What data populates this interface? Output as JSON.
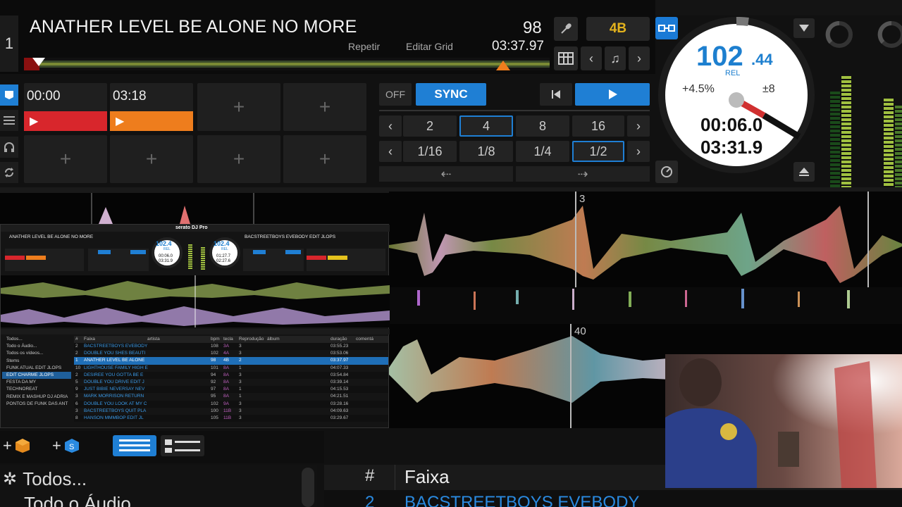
{
  "deck": {
    "number": "1",
    "title": "ANATHER LEVEL BE ALONE NO MORE",
    "bpm_small": "98",
    "repeat_label": "Repetir",
    "edit_grid_label": "Editar Grid",
    "time_remaining": "03:37.97",
    "key": "4B"
  },
  "cues": [
    {
      "time": "00:00",
      "color": "#d8262c"
    },
    {
      "time": "03:18",
      "color": "#ee7d1d"
    }
  ],
  "transport": {
    "off_label": "OFF",
    "sync_label": "SYNC",
    "beat_jump": [
      "2",
      "4",
      "8",
      "16"
    ],
    "beat_jump_active": "4",
    "loop_sizes": [
      "1/16",
      "1/8",
      "1/4",
      "1/2"
    ],
    "loop_active": "1/2"
  },
  "platter": {
    "bpm_int": "102",
    "bpm_dec": ".44",
    "rel_label": "REL",
    "pitch": "+4.5%",
    "range": "±8",
    "elapsed": "00:06.0",
    "remaining": "03:31.9"
  },
  "waveform": {
    "marker_top": "3",
    "marker_bottom": "40"
  },
  "embedded": {
    "app_name": "serato DJ Pro",
    "deck1_title": "ANATHER LEVEL BE ALONE NO MORE",
    "deck2_title": "BACSTREETBOYS EVEBODY EDIT JLOPS",
    "deck1_bpm": "102.4",
    "deck1_rel": "REL",
    "deck1_time1": "00:06.0",
    "deck1_time2": "03:31.9",
    "deck2_bpm": "102.4",
    "deck2_rel": "REL",
    "deck2_time1": "01:27.7",
    "deck2_time2": "02:27.6",
    "crates": [
      "Todos...",
      "Todo o Áudio...",
      "Todos os vídeos...",
      "Stems",
      "FUNK ATUAL EDIT JLOPS",
      "EDIT CHARME JLOPS",
      "FESTA DA MY",
      "TECHNOREAT",
      "REMIX E MASHUP DJ ADRIA",
      "PONTOS DE FUNK DAS ANT"
    ],
    "columns": [
      "#",
      "Faixa",
      "artista",
      "bpm",
      "tecla",
      "Reprodução",
      "álbum",
      "duração",
      "comentá"
    ],
    "rows": [
      {
        "n": "2",
        "track": "BACSTREETBOYS EVEBODY",
        "bpm": "108",
        "key": "3A",
        "plays": "3",
        "dur": "03:55.23"
      },
      {
        "n": "2",
        "track": "DOUBLE YOU SHES BEAUTI",
        "bpm": "102",
        "key": "4A",
        "plays": "3",
        "dur": "03:53.06"
      },
      {
        "n": "1",
        "track": "ANATHER LEVEL BE ALONE",
        "bpm": "98",
        "key": "4B",
        "plays": "2",
        "dur": "03:37.97"
      },
      {
        "n": "10",
        "track": "LIGHTHOUSE FAMILY HIGH E",
        "bpm": "101",
        "key": "8A",
        "plays": "1",
        "dur": "04:07.33"
      },
      {
        "n": "2",
        "track": "DESIREE YOU GOTTA BE E",
        "bpm": "94",
        "key": "8A",
        "plays": "3",
        "dur": "03:54.84"
      },
      {
        "n": "5",
        "track": "DOUBLE YOU DRIVE EDIT J",
        "bpm": "92",
        "key": "8A",
        "plays": "3",
        "dur": "03:39.14"
      },
      {
        "n": "9",
        "track": "JUST BIBIE NEVERSAY NEV",
        "bpm": "97",
        "key": "8A",
        "plays": "1",
        "dur": "04:15.53"
      },
      {
        "n": "3",
        "track": "MARK MORRISON RETURN",
        "bpm": "95",
        "key": "8A",
        "plays": "1",
        "dur": "04:21.51"
      },
      {
        "n": "6",
        "track": "DOUBLE YOU LOOK AT MY C",
        "bpm": "102",
        "key": "9A",
        "plays": "3",
        "dur": "03:28.16"
      },
      {
        "n": "3",
        "track": "BACSTREETBOYS QUIT PLA",
        "bpm": "100",
        "key": "11B",
        "plays": "3",
        "dur": "04:09.63"
      },
      {
        "n": "8",
        "track": "HANSON MMMBOP EDIT JL",
        "bpm": "105",
        "key": "11B",
        "plays": "3",
        "dur": "03:29.67"
      }
    ]
  },
  "library": {
    "sidebar_items": [
      "Todos...",
      "Todo o Áudio..."
    ],
    "col_hash": "#",
    "col_track": "Faixa",
    "first_row_num": "2",
    "first_row_track": "BACSTREETBOYS EVEBODY"
  },
  "colors": {
    "accent_blue": "#1f7fd4",
    "cue_red": "#d8262c",
    "cue_orange": "#ee7d1d",
    "key_yellow": "#e4b31d"
  }
}
